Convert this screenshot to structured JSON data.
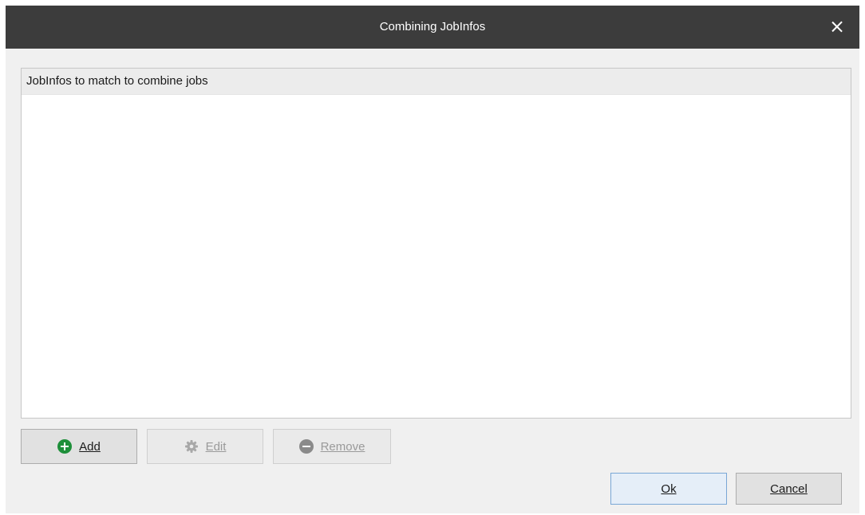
{
  "window": {
    "title": "Combining JobInfos",
    "close_icon": "close-icon"
  },
  "list": {
    "header": "JobInfos to match to combine jobs",
    "items": []
  },
  "buttons": {
    "add": {
      "label": "Add",
      "icon": "plus-circle-icon",
      "enabled": true
    },
    "edit": {
      "label": "Edit",
      "icon": "gear-icon",
      "enabled": false
    },
    "remove": {
      "label": "Remove",
      "icon": "minus-circle-icon",
      "enabled": false
    },
    "ok": {
      "label": "Ok"
    },
    "cancel": {
      "label": "Cancel"
    }
  },
  "colors": {
    "titlebar": "#3c3c3c",
    "add_icon": "#1e8f3a",
    "disabled_text": "#9a9a9a"
  }
}
